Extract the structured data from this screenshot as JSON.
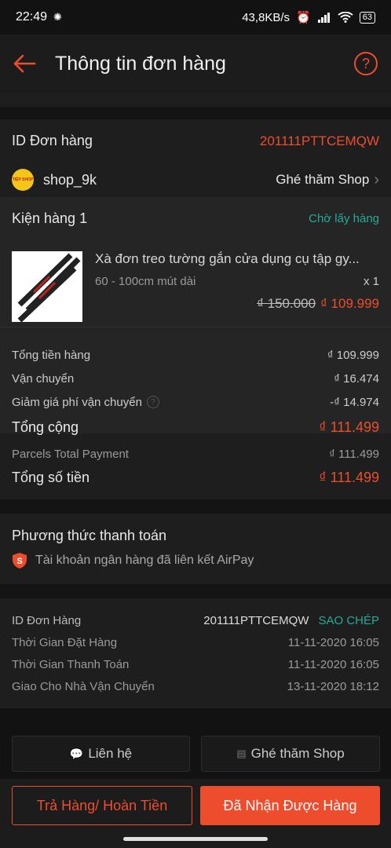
{
  "status_bar": {
    "time": "22:49",
    "network_speed": "43,8KB/s",
    "battery": "63"
  },
  "header": {
    "title": "Thông tin đơn hàng",
    "back_icon": "arrow-left-icon",
    "help_icon": "question-circle-icon"
  },
  "order": {
    "id_label": "ID Đơn hàng",
    "id_value": "201111PTTCEMQW"
  },
  "shop": {
    "logo_text": "TIỆP SHOP",
    "name": "shop_9k",
    "visit_label": "Ghé thăm Shop"
  },
  "parcel": {
    "title": "Kiện hàng 1",
    "status": "Chờ lấy hàng",
    "product": {
      "name": "Xà đơn treo tường gắn cửa dụng cụ tập gy...",
      "variant": "60 - 100cm mút dài",
      "quantity": "x 1",
      "original_price": "₫ 150.000",
      "sale_price": "₫ 109.999"
    }
  },
  "summary": {
    "subtotal_label": "Tổng tiền hàng",
    "subtotal_value": "₫ 109.999",
    "shipping_label": "Vận chuyển",
    "shipping_value": "₫ 16.474",
    "shipping_discount_label": "Giảm giá phí vận chuyển",
    "shipping_discount_value": "-₫ 14.974",
    "total_label": "Tổng cộng",
    "total_value": "₫ 111.499"
  },
  "payment_total": {
    "parcels_label": "Parcels Total Payment",
    "parcels_value": "₫ 111.499",
    "grand_label": "Tổng số tiền",
    "grand_value": "₫ 111.499"
  },
  "payment_method": {
    "title": "Phương thức thanh toán",
    "method": "Tài khoản ngân hàng đã liên kết AirPay"
  },
  "order_info": {
    "id_label": "ID Đơn Hàng",
    "id_value": "201111PTTCEMQW",
    "copy_label": "SAO CHÉP",
    "order_time_label": "Thời Gian Đặt Hàng",
    "order_time_value": "11-11-2020 16:05",
    "payment_time_label": "Thời Gian Thanh Toán",
    "payment_time_value": "11-11-2020 16:05",
    "handover_label": "Giao Cho Nhà Vận Chuyển",
    "handover_value": "13-11-2020 18:12"
  },
  "actions": {
    "contact_label": "Liên hệ",
    "visit_shop_label": "Ghé thăm Shop",
    "return_label": "Trả Hàng/ Hoàn Tiền",
    "received_label": "Đã Nhận Được Hàng"
  },
  "colors": {
    "accent": "#ee4d2d",
    "teal": "#26aa99",
    "background": "#121212",
    "card": "#1e1e1e"
  }
}
